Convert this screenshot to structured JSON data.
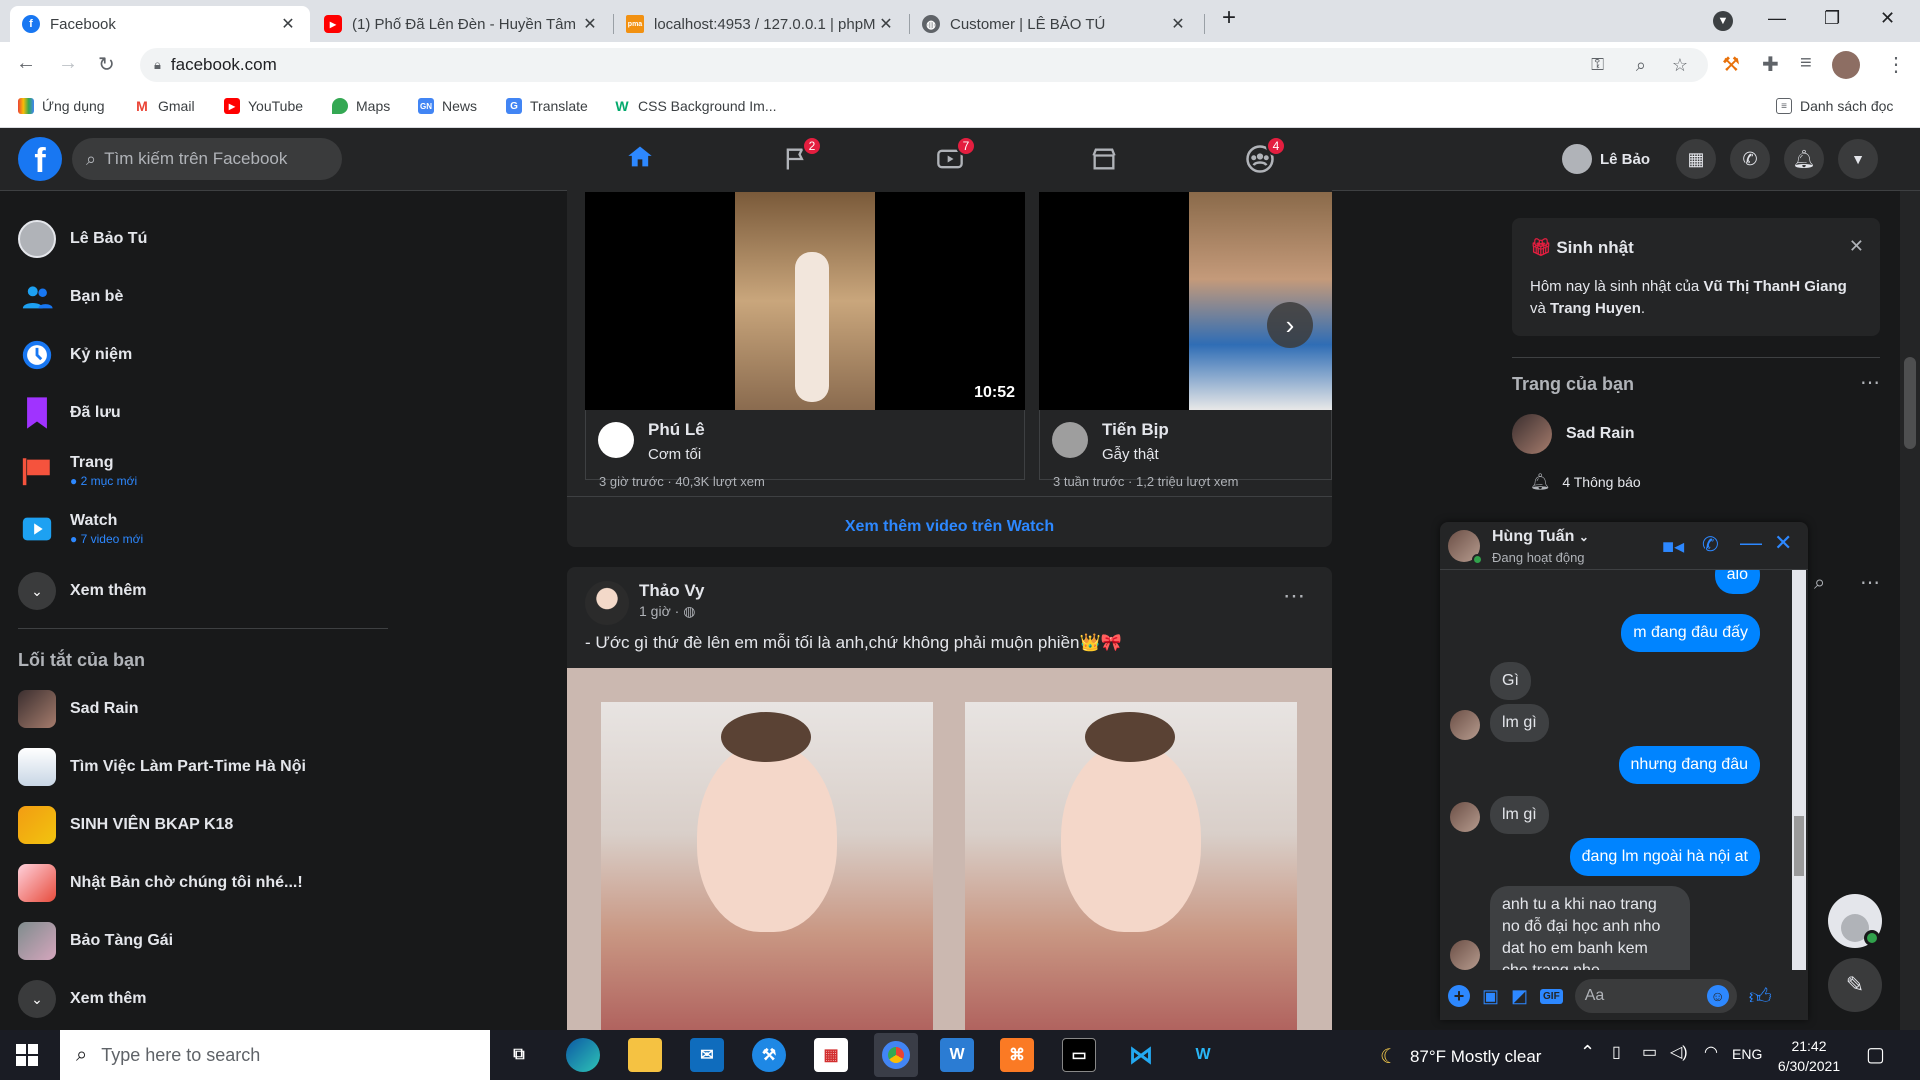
{
  "browser": {
    "tabs": [
      {
        "title": "Facebook",
        "icon": "facebook-icon",
        "color": "#1877f2",
        "glyph": "f"
      },
      {
        "title": "(1) Phố Đã Lên Đèn - Huyền Tâm",
        "icon": "youtube-icon",
        "color": "#ff0000",
        "glyph": "▶"
      },
      {
        "title": "localhost:4953 / 127.0.0.1 | phpM",
        "icon": "phpmyadmin-icon",
        "color": "#f29111",
        "glyph": "pma"
      },
      {
        "title": "Customer | LÊ BẢO TÚ",
        "icon": "globe-icon",
        "color": "#5f6368",
        "glyph": "◍"
      }
    ],
    "url": "facebook.com",
    "bookmarks": [
      {
        "label": "Ứng dụng",
        "icon": "apps-grid-icon",
        "color": "#ea4335",
        "glyph": "⋮⋮"
      },
      {
        "label": "Gmail",
        "icon": "gmail-icon",
        "color": "#ea4335",
        "glyph": "M"
      },
      {
        "label": "YouTube",
        "icon": "youtube-icon",
        "color": "#ff0000",
        "glyph": "▶"
      },
      {
        "label": "Maps",
        "icon": "maps-pin-icon",
        "color": "#34a853",
        "glyph": "●"
      },
      {
        "label": "News",
        "icon": "google-news-icon",
        "color": "#4285f4",
        "glyph": "GN"
      },
      {
        "label": "Translate",
        "icon": "translate-icon",
        "color": "#4285f4",
        "glyph": "G"
      },
      {
        "label": "CSS Background Im...",
        "icon": "w3schools-icon",
        "color": "#04aa6d",
        "glyph": "W"
      }
    ],
    "reading_list": "Danh sách đọc"
  },
  "fb": {
    "search_placeholder": "Tìm kiếm trên Facebook",
    "nav_badges": {
      "pages": "2",
      "watch": "7",
      "groups": "4"
    },
    "profile_name": "Lê Bảo",
    "sidebar": {
      "items": [
        {
          "label": "Lê Bảo Tú",
          "sub": ""
        },
        {
          "label": "Bạn bè",
          "sub": ""
        },
        {
          "label": "Kỷ niệm",
          "sub": ""
        },
        {
          "label": "Đã lưu",
          "sub": ""
        },
        {
          "label": "Trang",
          "sub": "2 mục mới"
        },
        {
          "label": "Watch",
          "sub": "7 video mới"
        },
        {
          "label": "Xem thêm",
          "sub": ""
        }
      ],
      "shortcuts_title": "Lối tắt của bạn",
      "shortcuts": [
        "Sad Rain",
        "Tìm Việc Làm Part-Time Hà Nội",
        "SINH VIÊN BKAP K18",
        "Nhật Bản chờ chúng tôi nhé...!",
        "Bảo Tàng Gái",
        "Xem thêm"
      ]
    },
    "watch_card": {
      "videos": [
        {
          "channel": "Phú Lê",
          "title": "Cơm tối",
          "meta": "3 giờ trước · 40,3K lượt xem",
          "duration": "10:52"
        },
        {
          "channel": "Tiến Bịp",
          "title": "Gẫy thật",
          "meta": "3 tuần trước · 1,2 triệu lượt xem",
          "duration": ""
        }
      ],
      "more_link": "Xem thêm video trên Watch"
    },
    "post": {
      "author": "Thảo Vy",
      "time": "1 giờ · ",
      "text": "- Ước gì thứ đè lên em mỗi tối là anh,chứ không phải muộn phiền👑🎀"
    },
    "right": {
      "birthday_title": "Sinh nhật",
      "birthday_prefix": "Hôm nay là sinh nhật của ",
      "birthday_name1": "Vũ Thị ThanH Giang",
      "birthday_mid": " và ",
      "birthday_name2": "Trang Huyen",
      "birthday_suffix": ".",
      "pages_title": "Trang của bạn",
      "page_name": "Sad Rain",
      "page_notifs": "4 Thông báo"
    },
    "chat": {
      "name": "Hùng Tuấn",
      "status": "Đang hoạt động",
      "messages": [
        {
          "dir": "out",
          "text": "alo"
        },
        {
          "dir": "out",
          "text": "m đang đâu đấy"
        },
        {
          "dir": "in",
          "text": "Gì"
        },
        {
          "dir": "in",
          "text": "lm gì"
        },
        {
          "dir": "out",
          "text": "nhưng đang đâu"
        },
        {
          "dir": "in",
          "text": "lm gì"
        },
        {
          "dir": "out",
          "text": "đang lm ngoài hà nội at"
        },
        {
          "dir": "in",
          "text": "anh tu a khi nao trang no đỗ đại  học anh nho dat ho em banh kem cho trang nhe"
        }
      ],
      "input_placeholder": "Aa"
    }
  },
  "taskbar": {
    "search_placeholder": "Type here to search",
    "weather": "87°F  Mostly clear",
    "lang": "ENG",
    "time": "21:42",
    "date": "6/30/2021"
  }
}
